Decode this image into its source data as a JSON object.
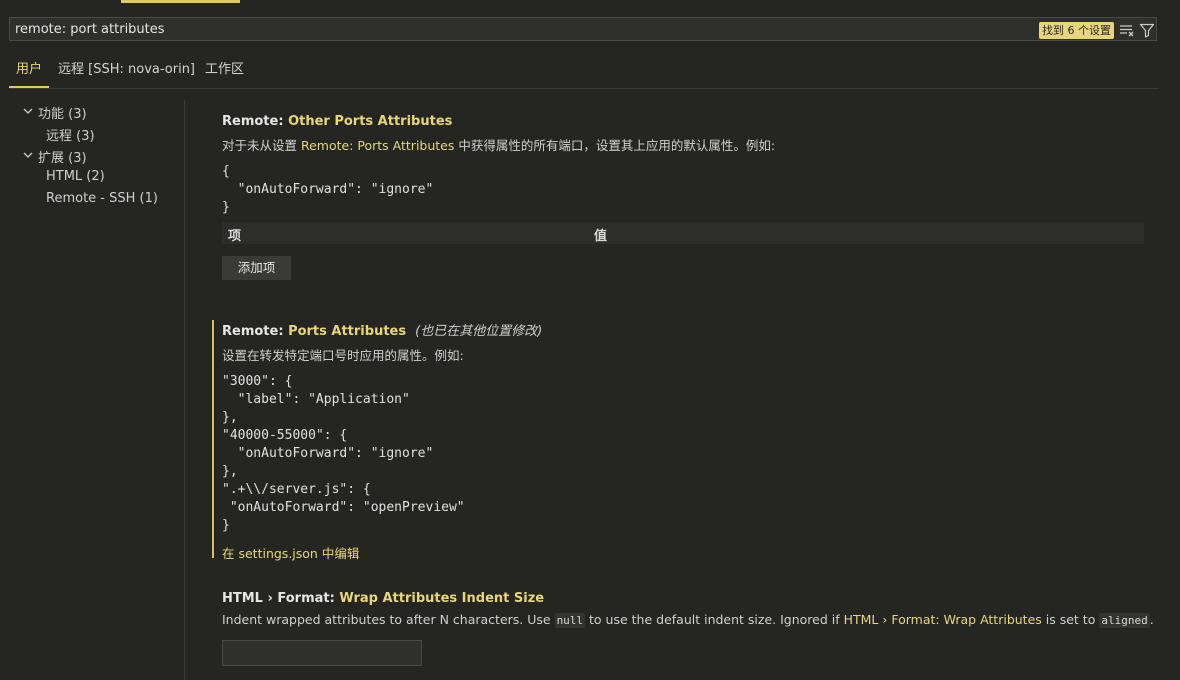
{
  "search": {
    "value": "remote: port attributes",
    "result_count": "找到 6 个设置"
  },
  "tabs": [
    {
      "label": "用户"
    },
    {
      "label": "远程 [SSH: nova-orin]"
    },
    {
      "label": "工作区"
    }
  ],
  "toc": [
    {
      "label": "功能 (3)"
    },
    {
      "label": "远程 (3)"
    },
    {
      "label": "扩展 (3)"
    },
    {
      "label": "HTML (2)"
    },
    {
      "label": "Remote - SSH (1)"
    }
  ],
  "settings": {
    "other_ports": {
      "prefix": "Remote: ",
      "name": "Other Ports Attributes",
      "desc_before": "对于未从设置 ",
      "desc_link": "Remote: Ports Attributes",
      "desc_after": " 中获得属性的所有端口，设置其上应用的默认属性。例如:",
      "code": "{\n  \"onAutoForward\": \"ignore\"\n}",
      "col_item": "项",
      "col_value": "值",
      "add_button": "添加项"
    },
    "ports_attributes": {
      "prefix": "Remote: ",
      "name": "Ports Attributes",
      "modified_note": "(也已在其他位置修改)",
      "desc": "设置在转发特定端口号时应用的属性。例如:",
      "code": "\"3000\": {\n  \"label\": \"Application\"\n},\n\"40000-55000\": {\n  \"onAutoForward\": \"ignore\"\n},\n\".+\\\\/server.js\": {\n \"onAutoForward\": \"openPreview\"\n}",
      "edit_link": "在 settings.json 中编辑"
    },
    "wrap_indent": {
      "prefix": "HTML › Format: ",
      "name": "Wrap Attributes Indent Size",
      "desc_1": "Indent wrapped attributes to after N characters. Use ",
      "code_null": "null",
      "desc_2": " to use the default indent size. Ignored if ",
      "desc_link": "HTML › Format: Wrap Attributes",
      "desc_3": " is set to ",
      "code_aligned": "aligned",
      "desc_4": ".",
      "value": ""
    }
  },
  "colors": {
    "background": "#252521",
    "accent": "#e8d778",
    "badge": "#e7d67a"
  }
}
